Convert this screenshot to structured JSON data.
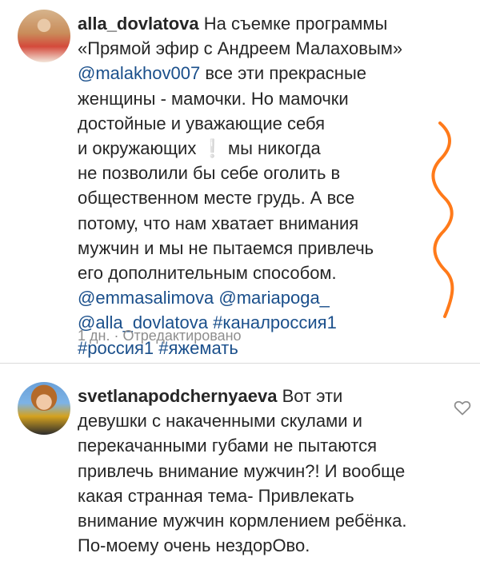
{
  "comments": [
    {
      "username": "alla_dovlatova",
      "lines": {
        "l1": "На съемке программы",
        "l2": "«Прямой эфир с Андреем Малаховым»",
        "l3_mention": "@malakhov007",
        "l3_rest": " все эти прекрасные",
        "l4": "женщины - мамочки. Но мамочки",
        "l5": "достойные и уважающие себя",
        "l6_a": "и окружающих ",
        "l6_excl": "❕",
        "l6_b": " мы никогда",
        "l7": "не позволили бы себе оголить в",
        "l8": "общественном месте грудь. А все",
        "l9": "потому, что нам хватает внимания",
        "l10": "мужчин и мы не пытаемся привлечь",
        "l11": "его дополнительным способом."
      },
      "tags": {
        "t1": "@emmasalimova",
        "t2": "@mariapoga_",
        "t3": "@alla_dovlatova",
        "t4": "#каналроссия1",
        "t5": "#россия1",
        "t6": "#яжемать"
      },
      "meta": "1 дн. · Отредактировано"
    },
    {
      "username": "svetlanapodchernyaeva",
      "text": "Вот эти девушки с накаченными скулами и перекачанными губами не пытаются привлечь внимание мужчин?! И вообще какая странная тема- Привлекать внимание мужчин кормлением ребёнка. По-моему очень нездорОво."
    }
  ],
  "colors": {
    "link": "#1a4f8b",
    "annotation": "#ff7a1a",
    "meta": "#8e8e8e"
  },
  "icons": {
    "like": "heart-outline-icon"
  }
}
